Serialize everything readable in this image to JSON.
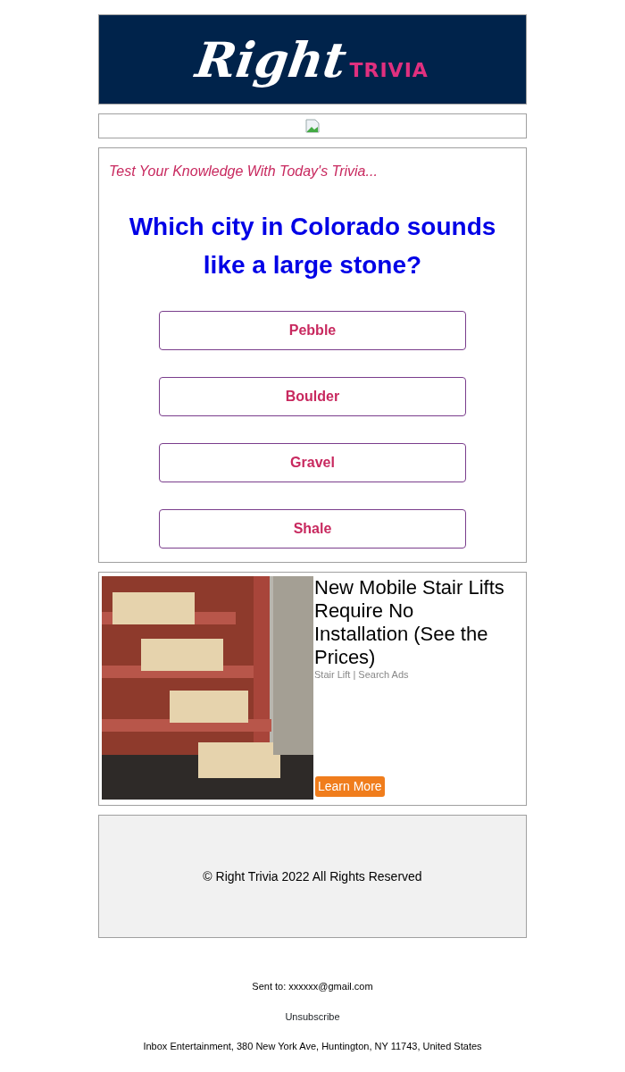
{
  "header": {
    "logo_script": "Right",
    "logo_word": "TRIVIA"
  },
  "banner": {
    "kind": "broken-image"
  },
  "quiz": {
    "intro": "Test Your Knowledge With Today's Trivia...",
    "question": "Which city in Colorado sounds like a large stone?",
    "answers": [
      {
        "label": "Pebble"
      },
      {
        "label": "Boulder"
      },
      {
        "label": "Gravel"
      },
      {
        "label": "Shale"
      }
    ]
  },
  "ad": {
    "headline": "New Mobile Stair Lifts Require No Installation (See the Prices)",
    "source": "Stair Lift | Search Ads",
    "button": "Learn More"
  },
  "copyright": "© Right Trivia 2022 All Rights Reserved",
  "footer": {
    "sent_to": "Sent to: xxxxxx@gmail.com",
    "unsubscribe": "Unsubscribe",
    "address": "Inbox Entertainment, 380 New York Ave, Huntington, NY 11743, United States"
  }
}
